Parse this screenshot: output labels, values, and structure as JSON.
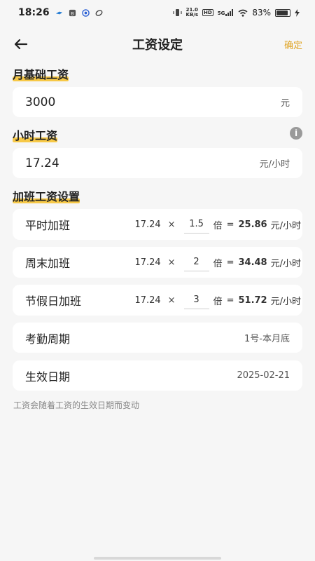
{
  "status_bar": {
    "time": "18:26",
    "speed_top": "21.0",
    "speed_bottom": "KB/s",
    "hd": "HD",
    "net": "5G",
    "battery": "83%"
  },
  "header": {
    "title": "工资设定",
    "confirm_label": "确定"
  },
  "monthly_base": {
    "section_label": "月基础工资",
    "value": "3000",
    "unit": "元"
  },
  "hourly": {
    "section_label": "小时工资",
    "value": "17.24",
    "unit": "元/小时"
  },
  "overtime": {
    "section_label": "加班工资设置",
    "times_symbol": "×",
    "multiplier_unit": "倍",
    "equals": "=",
    "result_unit": "元/小时",
    "rows": [
      {
        "label": "平时加班",
        "base": "17.24",
        "multiplier": "1.5",
        "result": "25.86"
      },
      {
        "label": "周末加班",
        "base": "17.24",
        "multiplier": "2",
        "result": "34.48"
      },
      {
        "label": "节假日加班",
        "base": "17.24",
        "multiplier": "3",
        "result": "51.72"
      }
    ]
  },
  "attendance": {
    "label": "考勤周期",
    "value": "1号-本月底"
  },
  "effective": {
    "label": "生效日期",
    "value": "2025-02-21"
  },
  "note": "工资会随着工资的生效日期而变动",
  "colors": {
    "accent": "#f7c948",
    "confirm": "#e0a526",
    "background": "#f6f6f6"
  }
}
